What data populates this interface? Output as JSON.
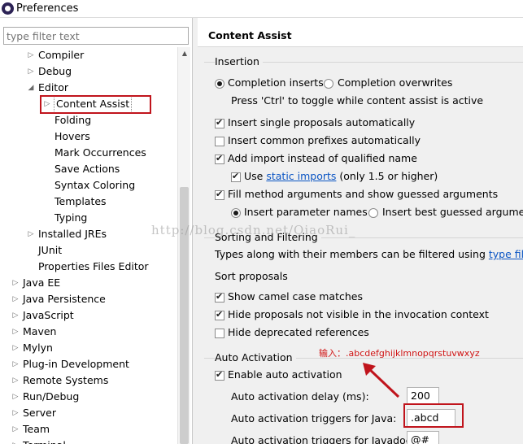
{
  "window": {
    "title": "Preferences"
  },
  "filter": {
    "placeholder": "type filter text"
  },
  "tree": [
    {
      "label": "Compiler",
      "arrow": "▷"
    },
    {
      "label": "Debug",
      "arrow": "▷"
    },
    {
      "label": "Editor",
      "arrow": "◢"
    },
    {
      "label": "Content Assist",
      "arrow": "▷",
      "selected": true
    },
    {
      "label": "Folding",
      "arrow": ""
    },
    {
      "label": "Hovers",
      "arrow": ""
    },
    {
      "label": "Mark Occurrences",
      "arrow": ""
    },
    {
      "label": "Save Actions",
      "arrow": ""
    },
    {
      "label": "Syntax Coloring",
      "arrow": ""
    },
    {
      "label": "Templates",
      "arrow": ""
    },
    {
      "label": "Typing",
      "arrow": ""
    },
    {
      "label": "Installed JREs",
      "arrow": "▷"
    },
    {
      "label": "JUnit",
      "arrow": ""
    },
    {
      "label": "Properties Files Editor",
      "arrow": ""
    },
    {
      "label": "Java EE",
      "arrow": "▷"
    },
    {
      "label": "Java Persistence",
      "arrow": "▷"
    },
    {
      "label": "JavaScript",
      "arrow": "▷"
    },
    {
      "label": "Maven",
      "arrow": "▷"
    },
    {
      "label": "Mylyn",
      "arrow": "▷"
    },
    {
      "label": "Plug-in Development",
      "arrow": "▷"
    },
    {
      "label": "Remote Systems",
      "arrow": "▷"
    },
    {
      "label": "Run/Debug",
      "arrow": "▷"
    },
    {
      "label": "Server",
      "arrow": "▷"
    },
    {
      "label": "Team",
      "arrow": "▷"
    },
    {
      "label": "Terminal",
      "arrow": "▷"
    }
  ],
  "page": {
    "title": "Content Assist",
    "insertion": {
      "title": "Insertion",
      "completion_inserts": "Completion inserts",
      "completion_overwrites": "Completion overwrites",
      "hint": "Press 'Ctrl' to toggle while content assist is active",
      "single_proposals": "Insert single proposals automatically",
      "common_prefixes": "Insert common prefixes automatically",
      "add_import": "Add import instead of qualified name",
      "use": "Use",
      "static_imports": "static imports",
      "only_15": "(only 1.5 or higher)",
      "fill_method": "Fill method arguments and show guessed arguments",
      "insert_param_names": "Insert parameter names",
      "insert_best_guessed": "Insert best guessed arguments"
    },
    "sorting": {
      "title": "Sorting and Filtering",
      "types_text": "Types along with their members can be filtered using",
      "type_filters": "type filters",
      "sort_proposals": "Sort proposals",
      "camel_case": "Show camel case matches",
      "hide_not_visible": "Hide proposals not visible in the invocation context",
      "hide_deprecated": "Hide deprecated references"
    },
    "auto_activation": {
      "title": "Auto Activation",
      "enable": "Enable auto activation",
      "delay_label": "Auto activation delay (ms):",
      "delay_value": "200",
      "java_triggers_label": "Auto activation triggers for Java:",
      "java_triggers_value": ".abcd",
      "javadoc_triggers_label": "Auto activation triggers for Javadoc:",
      "javadoc_triggers_value": "@#"
    }
  },
  "annotation": {
    "text": "输入：.abcdefghijklmnopqrstuvwxyz"
  },
  "watermark": {
    "text": "http://blog.csdn.net/QiaoRui_"
  },
  "colors": {
    "annotation_red": "#c0141c",
    "link_blue": "#0b55c4"
  }
}
